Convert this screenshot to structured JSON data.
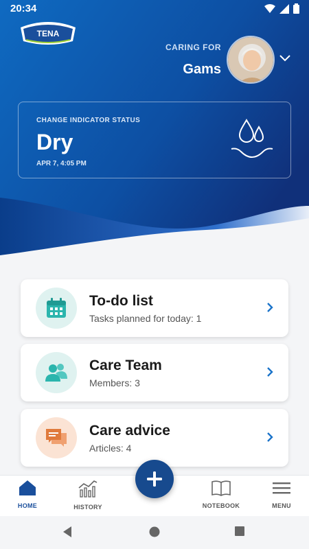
{
  "status_bar": {
    "time": "20:34"
  },
  "brand": {
    "logo_text": "TENA"
  },
  "header": {
    "caring_label": "CARING FOR",
    "caring_name": "Gams"
  },
  "status_card": {
    "label": "CHANGE INDICATOR STATUS",
    "value": "Dry",
    "timestamp": "APR 7, 4:05 PM"
  },
  "cards": [
    {
      "title": "To-do list",
      "subtitle": "Tasks planned for today: 1",
      "icon": "calendar-icon",
      "color": "#2bb5ad"
    },
    {
      "title": "Care Team",
      "subtitle": "Members: 3",
      "icon": "people-icon",
      "color": "#2bb5ad"
    },
    {
      "title": "Care advice",
      "subtitle": "Articles: 4",
      "icon": "chat-icon",
      "color": "#e07a3c"
    }
  ],
  "bottom_nav": {
    "home": "HOME",
    "history": "HISTORY",
    "notebook": "NOTEBOOK",
    "menu": "MENU"
  },
  "colors": {
    "primary": "#174a8e",
    "accent_teal": "#2bb5ad",
    "accent_orange": "#e07a3c"
  }
}
